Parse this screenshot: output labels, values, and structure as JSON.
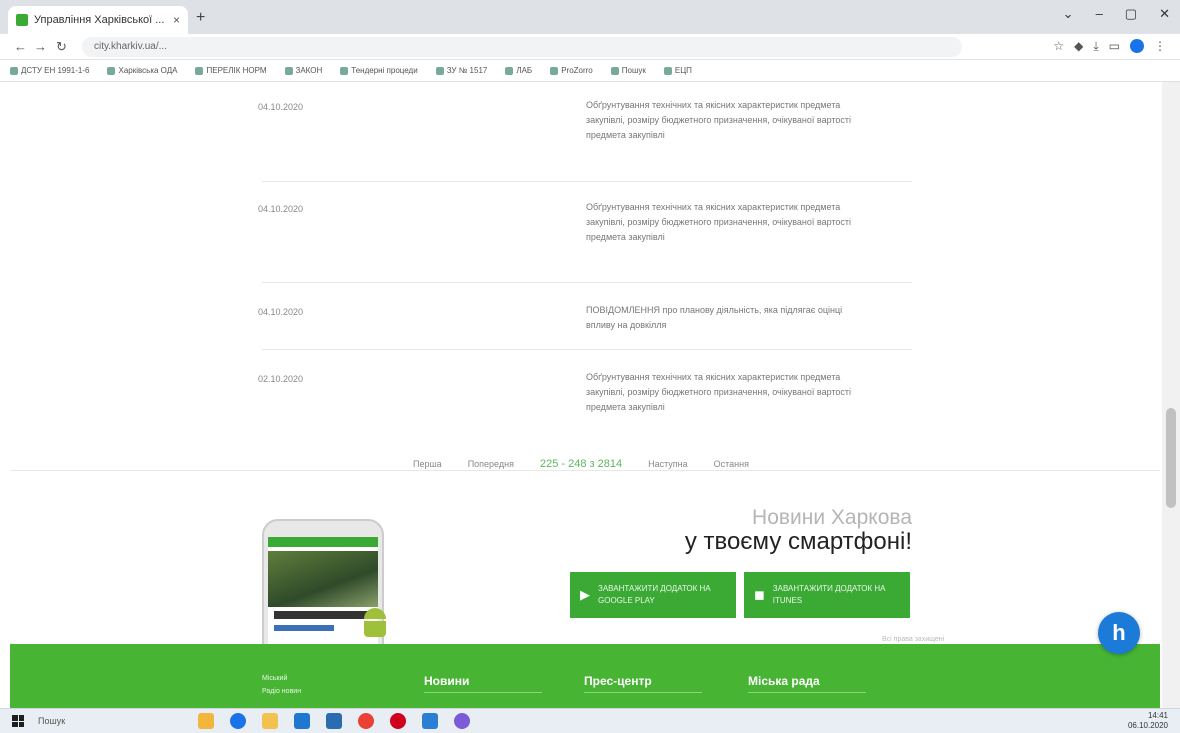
{
  "browser": {
    "tab_title": "Управління Харківської ...",
    "url": "city.kharkiv.ua/...",
    "bookmarks": [
      "ДСТУ ЕН 1991-1-6",
      "Харківська ОДА",
      "ПЕРЕЛІК НОРМ",
      "ЗАКОН",
      "Тендерні процеди",
      "ЗУ № 1517",
      "ЛАБ",
      "ProZorro",
      "Пошук",
      "ЕЦП"
    ]
  },
  "list": {
    "rows": [
      {
        "date": "04.10.2020",
        "text": "Обґрунтування технічних та якісних характеристик предмета закупівлі, розміру бюджетного призначення, очікуваної вартості предмета закупівлі"
      },
      {
        "date": "04.10.2020",
        "text": "Обґрунтування технічних та якісних характеристик предмета закупівлі, розміру бюджетного призначення, очікуваної вартості предмета закупівлі"
      },
      {
        "date": "04.10.2020",
        "text": "ПОВІДОМЛЕННЯ про планову діяльність, яка підлягає оцінці впливу на довкілля"
      },
      {
        "date": "02.10.2020",
        "text": "Обґрунтування технічних та якісних характеристик предмета закупівлі, розміру бюджетного призначення, очікуваної вартості предмета закупівлі"
      }
    ]
  },
  "pagination": {
    "first": "Перша",
    "prev": "Попередня",
    "current": "225 - 248 з 2814",
    "next": "Наступна",
    "last": "Остання"
  },
  "promo": {
    "title_line1": "Новини Харкова",
    "title_line2": "у твоєму смартфоні!",
    "google_play": "ЗАВАНТАЖИТИ ДОДАТОК НА GOOGLE PLAY",
    "app_store": "ЗАВАНТАЖИТИ ДОДАТОК НА ITUNES",
    "copyright": "Всі права захищені"
  },
  "footer": {
    "links": [
      "Міський",
      "Радіо новин"
    ],
    "col1": "Новини",
    "col2": "Прес-центр",
    "col3": "Міська рада"
  },
  "taskbar": {
    "search": "Пошук",
    "time": "14:41",
    "date": "06.10.2020"
  }
}
